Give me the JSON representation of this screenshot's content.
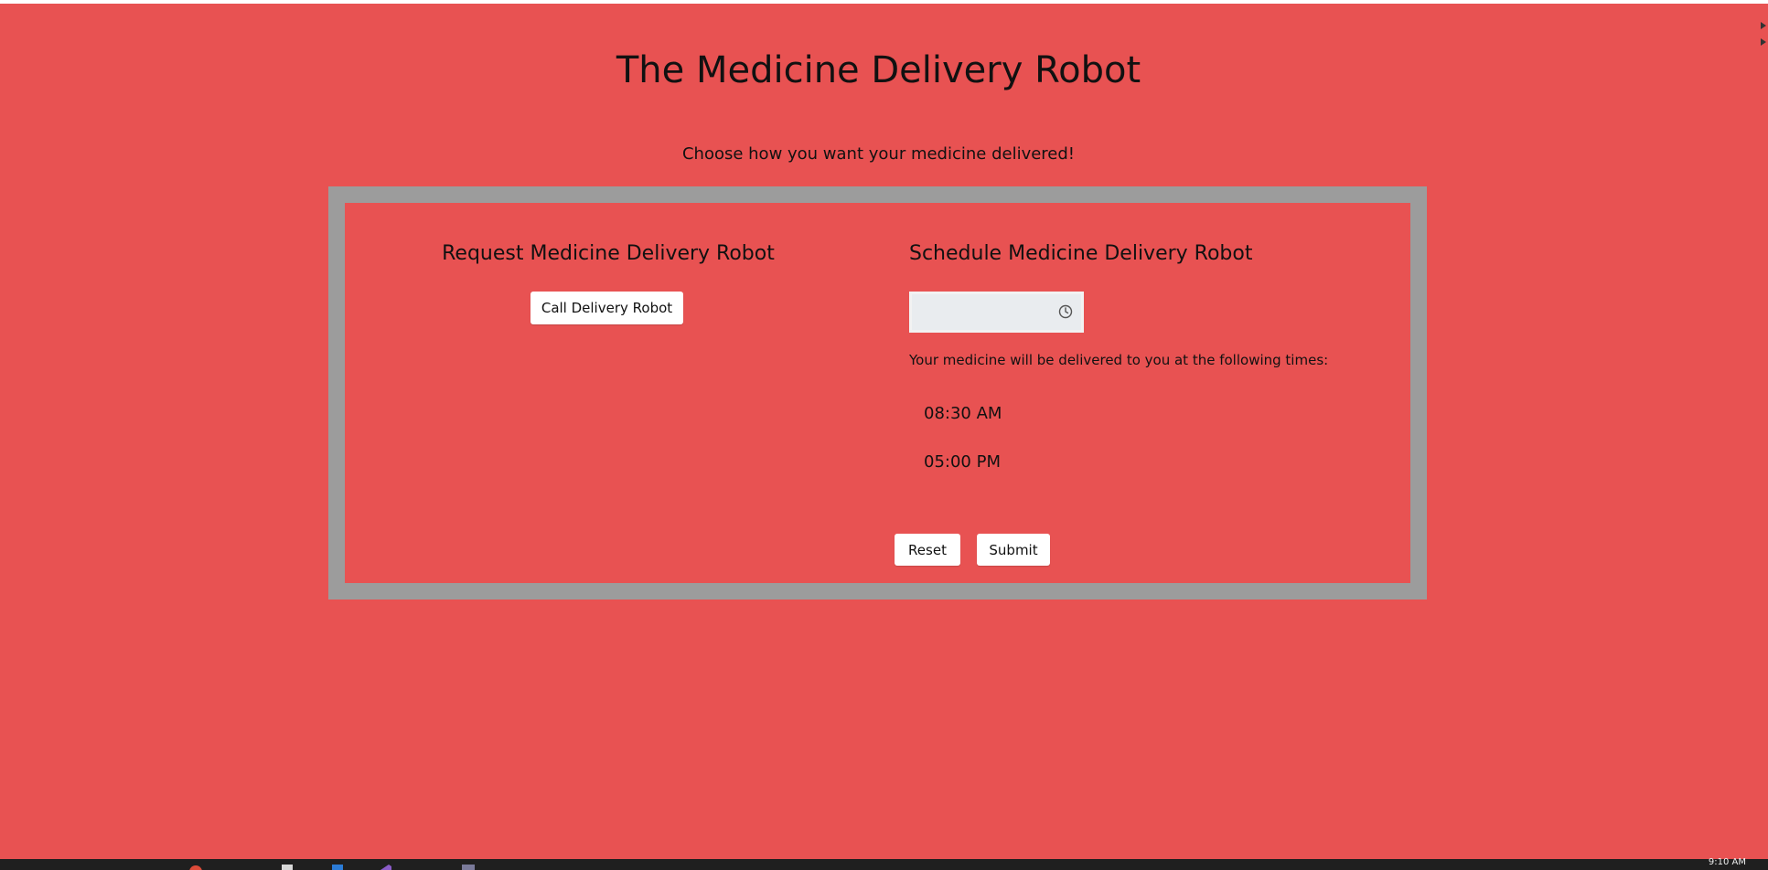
{
  "page": {
    "title": "The Medicine Delivery Robot",
    "subtitle": "Choose how you want your medicine delivered!"
  },
  "request_section": {
    "title": "Request Medicine Delivery Robot",
    "call_button_label": "Call Delivery Robot"
  },
  "schedule_section": {
    "title": "Schedule Medicine Delivery Robot",
    "time_input_value": "",
    "delivery_note": "Your medicine will be delivered to you at the following times:",
    "times": [
      "08:30 AM",
      "05:00 PM"
    ]
  },
  "actions": {
    "reset_label": "Reset",
    "submit_label": "Submit"
  },
  "taskbar": {
    "clock": "9:10 AM",
    "icons": [
      "chrome-icon",
      "file-icon",
      "window-icon",
      "visual-studio-icon",
      "app-icon"
    ]
  },
  "colors": {
    "background": "#e85252",
    "card_border": "#9c9c9c",
    "button_bg": "#ffffff",
    "input_bg": "#e9ecef"
  }
}
